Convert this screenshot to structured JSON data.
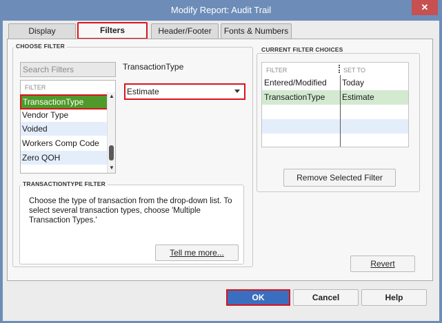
{
  "window": {
    "title": "Modify Report: Audit Trail",
    "close_glyph": "✕"
  },
  "tabs": [
    {
      "label": "Display",
      "active": false
    },
    {
      "label": "Filters",
      "active": true
    },
    {
      "label": "Header/Footer",
      "active": false
    },
    {
      "label": "Fonts & Numbers",
      "active": false
    }
  ],
  "choose_filter": {
    "title": "CHOOSE FILTER",
    "search_placeholder": "Search Filters",
    "list_header": "FILTER",
    "items": [
      {
        "label": "TransactionType",
        "state": "selected"
      },
      {
        "label": "Vendor Type",
        "state": "normal"
      },
      {
        "label": "Voided",
        "state": "alt"
      },
      {
        "label": "Workers Comp Code",
        "state": "normal"
      },
      {
        "label": "Zero QOH",
        "state": "alt"
      }
    ],
    "scroll_up": "▲",
    "scroll_down": "▼"
  },
  "transaction_type": {
    "label": "TransactionType",
    "selected": "Estimate"
  },
  "help_box": {
    "title": "TRANSACTIONTYPE FILTER",
    "line1": "Choose the type of transaction from the drop-down list. To",
    "line2": "select several transaction types, choose 'Multiple",
    "line3": "Transaction Types.'",
    "tell_more_label": "Tell me more..."
  },
  "current_filters": {
    "title": "CURRENT FILTER CHOICES",
    "col_filter": "FILTER",
    "col_set_to": "SET TO",
    "rows": [
      {
        "filter": "Entered/Modified",
        "set_to": "Today",
        "style": "normal"
      },
      {
        "filter": "TransactionType",
        "set_to": "Estimate",
        "style": "green"
      }
    ],
    "remove_label": "Remove Selected Filter"
  },
  "buttons": {
    "revert": "Revert",
    "ok": "OK",
    "cancel": "Cancel",
    "help": "Help"
  },
  "colors": {
    "title_bar": "#6d8db8",
    "selected_row": "#4f9a2a",
    "highlight_box": "#d8141a",
    "ok_button": "#3a6fc0"
  }
}
